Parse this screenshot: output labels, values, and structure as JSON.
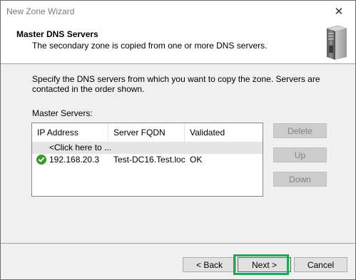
{
  "window": {
    "title": "New Zone Wizard",
    "close_glyph": "✕"
  },
  "header": {
    "title": "Master DNS Servers",
    "subtitle": "The secondary zone is copied from one or more DNS servers.",
    "icon": "server-icon"
  },
  "body": {
    "description": "Specify the DNS servers from which you want to copy the zone.  Servers are contacted in the order shown.",
    "list_label": "Master Servers:"
  },
  "servers_list": {
    "columns": [
      "IP Address",
      "Server FQDN",
      "Validated"
    ],
    "add_row_text": "<Click here to ...",
    "rows": [
      {
        "status_icon": "check-circle-icon",
        "ip": "192.168.20.3",
        "fqdn": "Test-DC16.Test.loc",
        "validated": "OK"
      }
    ]
  },
  "side_buttons": {
    "delete": "Delete",
    "up": "Up",
    "down": "Down"
  },
  "footer": {
    "back": "< Back",
    "next": "Next >",
    "cancel": "Cancel"
  },
  "colors": {
    "highlight": "#1fa84a",
    "check": "#3a9f2a",
    "default_button_border": "#0078d7"
  }
}
